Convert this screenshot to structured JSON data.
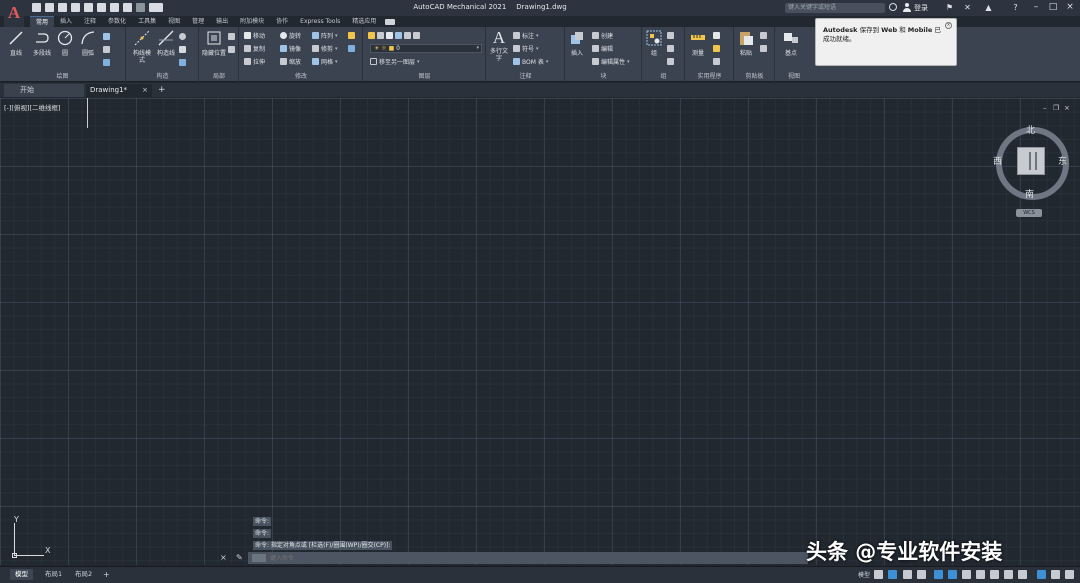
{
  "titlebar": {
    "app_title": "AutoCAD Mechanical 2021",
    "document": "Drawing1.dwg",
    "search_placeholder": "键入关键字或短语",
    "login": "登录",
    "app_logo": "A",
    "quick_access_icons": [
      "new-icon",
      "open-icon",
      "save-icon",
      "saveas-icon",
      "print-icon",
      "undo-icon",
      "redo-icon",
      "workspace-icon"
    ]
  },
  "ribbon_tabs": [
    "常用",
    "插入",
    "注释",
    "参数化",
    "工具集",
    "视图",
    "管理",
    "输出",
    "附加模块",
    "协作",
    "Express Tools",
    "精选应用"
  ],
  "ribbon_active_tab": 0,
  "ribbon": {
    "draw": {
      "label": "绘图",
      "line": "直线",
      "polyline": "多段线",
      "circle": "圆",
      "arc": "圆弧"
    },
    "construct": {
      "label": "构造",
      "lines_mode": "构线模式",
      "construction_line": "构造线"
    },
    "detail": {
      "label": "局部",
      "hide_position": "隐藏位置"
    },
    "modify": {
      "label": "修改",
      "move": "移动",
      "rotate": "旋转",
      "array": "阵列",
      "copy": "复制",
      "mirror": "镜像",
      "fillet": "修剪",
      "stretch": "拉伸",
      "scale": "缩放",
      "mesh": "网格"
    },
    "layers": {
      "label": "图层",
      "layer_value": "0",
      "match_layer": "移至另一图层"
    },
    "annotation": {
      "label": "注释",
      "mtext": "多行文字",
      "dimension": "标注",
      "leader": "符号",
      "bom": "BOM 表"
    },
    "block": {
      "label": "块",
      "insert": "插入",
      "create": "创建",
      "edit": "编辑",
      "edit_attrib": "编辑属性"
    },
    "groups": {
      "label": "组",
      "group": "组"
    },
    "utilities": {
      "label": "实用程序",
      "measure": "测量"
    },
    "clipboard": {
      "label": "剪贴板",
      "paste": "粘贴"
    },
    "view": {
      "label": "视图",
      "base": "基点"
    }
  },
  "notification": {
    "brand": "Autodesk",
    "text_before": "保存到",
    "web": "Web",
    "and": "和",
    "mobile": "Mobile",
    "text_after": "已成功就绪。"
  },
  "file_tabs": {
    "start": "开始",
    "drawing": "Drawing1*",
    "close": "×",
    "add": "+"
  },
  "viewport": {
    "label": "[-][俯视][二维线框]",
    "controls": [
      "–",
      "❐",
      "×"
    ]
  },
  "viewcube": {
    "north": "北",
    "south": "南",
    "east": "东",
    "west": "西",
    "wcs": "WCS"
  },
  "ucs": {
    "x": "X",
    "y": "Y"
  },
  "command": {
    "history": [
      "命令:",
      "命令:",
      "命令: 指定对角点或 [栏选(F)/圈围(WP)/圈交(CP)]:"
    ],
    "placeholder": "键入命令"
  },
  "status": {
    "layout_tabs": [
      "模型",
      "布局1",
      "布局2"
    ],
    "add_tab": "+",
    "model_label": "模型"
  },
  "watermark": "头条 @专业软件安装",
  "colors": {
    "canvas": "#212830",
    "ribbon": "#3b4350",
    "titlebar": "#2d3440",
    "accent": "#3d8fd6"
  }
}
